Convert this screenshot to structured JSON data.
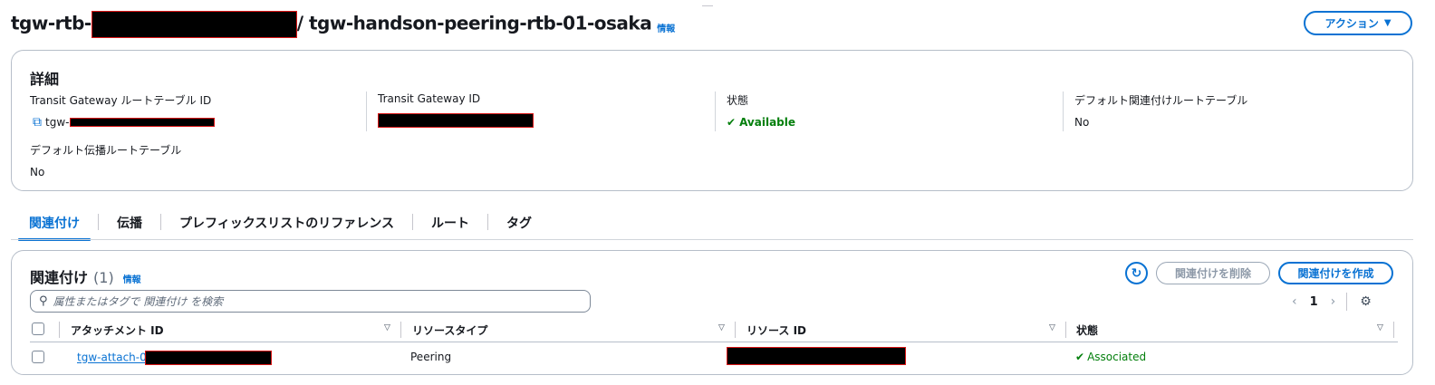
{
  "header": {
    "title_prefix": "tgw-rtb-",
    "title_suffix": "/ tgw-handson-peering-rtb-01-osaka",
    "info": "情報",
    "action_label": "アクション",
    "action_caret": "▼"
  },
  "details": {
    "heading": "詳細",
    "route_table_id_label": "Transit Gateway ルートテーブル ID",
    "route_table_id_prefix": "tgw-",
    "transit_gateway_id_label": "Transit Gateway ID",
    "state_label": "状態",
    "state_value": "Available",
    "default_association_label": "デフォルト関連付けルートテーブル",
    "default_association_value": "No",
    "default_propagation_label": "デフォルト伝播ルートテーブル",
    "default_propagation_value": "No"
  },
  "tabs": [
    {
      "label": "関連付け",
      "active": true
    },
    {
      "label": "伝播",
      "active": false
    },
    {
      "label": "プレフィックスリストのリファレンス",
      "active": false
    },
    {
      "label": "ルート",
      "active": false
    },
    {
      "label": "タグ",
      "active": false
    }
  ],
  "associations": {
    "title": "関連付け",
    "count": "(1)",
    "info": "情報",
    "delete_label": "関連付けを削除",
    "create_label": "関連付けを作成",
    "search_placeholder": "属性またはタグで 関連付け を検索",
    "page": "1",
    "columns": [
      "アタッチメント ID",
      "リソースタイプ",
      "リソース ID",
      "状態"
    ],
    "rows": [
      {
        "attachment_prefix": "tgw-attach-0",
        "resource_type": "Peering",
        "state": "Associated"
      }
    ]
  },
  "colors": {
    "link": "#0972d3",
    "success": "#037f0c",
    "redaction_border": "#d91515"
  }
}
